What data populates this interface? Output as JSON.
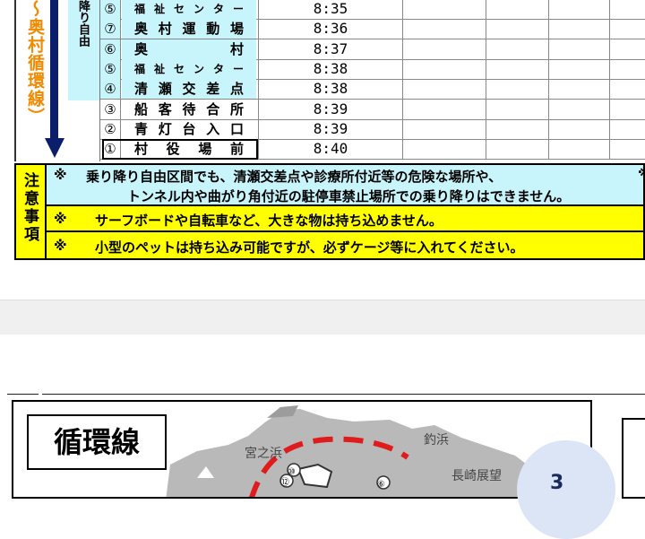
{
  "schedule": {
    "side_label": "〜奥村循環線）",
    "side_note": "降り自由",
    "rows": [
      {
        "num": "⑤",
        "name": "福祉センター",
        "time": "8:35",
        "small": true,
        "cyan": true
      },
      {
        "num": "⑦",
        "name": "奥村運動場",
        "time": "8:36",
        "small": false,
        "cyan": true
      },
      {
        "num": "⑥",
        "name": "奥　村",
        "time": "8:37",
        "small": false,
        "cyan": true
      },
      {
        "num": "⑤",
        "name": "福祉センター",
        "time": "8:38",
        "small": true,
        "cyan": true
      },
      {
        "num": "④",
        "name": "清瀬交差点",
        "time": "8:38",
        "small": false,
        "cyan": true
      },
      {
        "num": "③",
        "name": "船客待合所",
        "time": "8:39",
        "small": false,
        "cyan": false
      },
      {
        "num": "②",
        "name": "青灯台入口",
        "time": "8:39",
        "small": false,
        "cyan": false
      },
      {
        "num": "①",
        "name": "村役場前",
        "time": "8:40",
        "small": false,
        "cyan": false
      }
    ]
  },
  "notes": {
    "label": "注意事項",
    "mark": "※",
    "right_mark": "※",
    "items": [
      {
        "line1": "乗り降り自由区間でも、清瀬交差点や診療所付近等の危険な場所や、",
        "line2": "トンネル内や曲がり角付近の駐停車禁止場所での乗り降りはできません。",
        "color": "#c7f5fb"
      },
      {
        "line1": "サーフボードや自転車など、大きな物は持ち込めません。",
        "line2": "",
        "color": "#ffff00"
      },
      {
        "line1": "小型のペットは持ち込み可能ですが、必ずケージ等に入れてください。",
        "line2": "",
        "color": "#ffff00"
      }
    ]
  },
  "map": {
    "title": "循環線",
    "places": {
      "miyanohama": "宮之浜",
      "tsurihama": "釣浜",
      "nagasaki": "長崎展望"
    },
    "stop_numbers": [
      "⑩",
      "⑫",
      "⑥"
    ]
  },
  "fab": {
    "label": "3"
  },
  "colors": {
    "cyan": "#c7f5fb",
    "yellow": "#ffff00",
    "orange": "#f08a00",
    "navy": "#0b1e6b",
    "route_red": "#e01b1b"
  }
}
